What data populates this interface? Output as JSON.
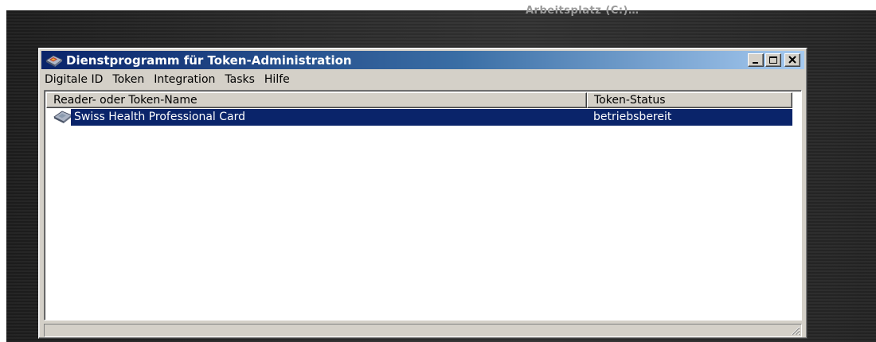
{
  "background_text": "Arbeitsplatz (C:)…",
  "window": {
    "title": "Dienstprogramm für Token-Administration",
    "icon": "token-card-icon",
    "controls": [
      "minimize-icon",
      "maximize-icon",
      "close-icon"
    ]
  },
  "menu": {
    "items": [
      {
        "label": "Digitale ID"
      },
      {
        "label": "Token"
      },
      {
        "label": "Integration"
      },
      {
        "label": "Tasks"
      },
      {
        "label": "Hilfe"
      }
    ]
  },
  "list": {
    "columns": [
      {
        "label": "Reader- oder Token-Name"
      },
      {
        "label": "Token-Status"
      }
    ],
    "rows": [
      {
        "name": "Swiss Health Professional Card",
        "status": "betriebsbereit",
        "icon": "token-card-icon",
        "selected": true
      }
    ]
  },
  "statusbar": {
    "text": ""
  },
  "colors": {
    "titlebar_start": "#0a246a",
    "titlebar_end": "#a6caf0",
    "selection": "#0a246a",
    "window_face": "#d4d0c8"
  }
}
